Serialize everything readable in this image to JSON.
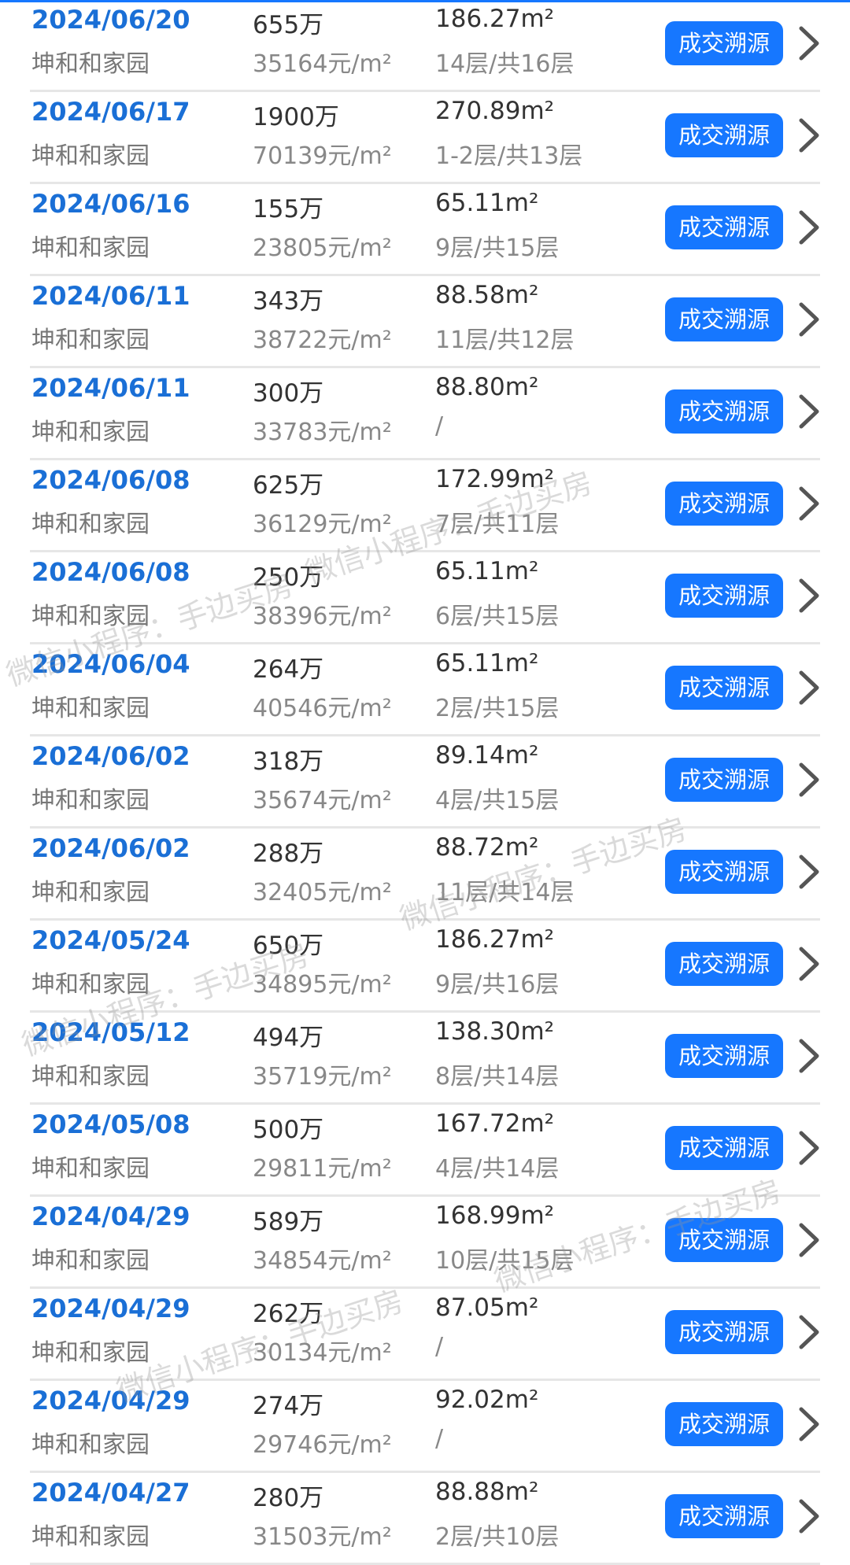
{
  "button_label": "成交溯源",
  "accent_color": "#1677ff",
  "icons": {
    "chevron": "chevron-right-icon"
  },
  "watermark_text": "微信小程序：手边买房",
  "records": [
    {
      "date": "2024/06/20",
      "community": "坤和和家园",
      "price": "655万",
      "unit_price": "35164元/m²",
      "area": "186.27m²",
      "floor": "14层/共16层"
    },
    {
      "date": "2024/06/17",
      "community": "坤和和家园",
      "price": "1900万",
      "unit_price": "70139元/m²",
      "area": "270.89m²",
      "floor": "1-2层/共13层"
    },
    {
      "date": "2024/06/16",
      "community": "坤和和家园",
      "price": "155万",
      "unit_price": "23805元/m²",
      "area": "65.11m²",
      "floor": "9层/共15层"
    },
    {
      "date": "2024/06/11",
      "community": "坤和和家园",
      "price": "343万",
      "unit_price": "38722元/m²",
      "area": "88.58m²",
      "floor": "11层/共12层"
    },
    {
      "date": "2024/06/11",
      "community": "坤和和家园",
      "price": "300万",
      "unit_price": "33783元/m²",
      "area": "88.80m²",
      "floor": "/"
    },
    {
      "date": "2024/06/08",
      "community": "坤和和家园",
      "price": "625万",
      "unit_price": "36129元/m²",
      "area": "172.99m²",
      "floor": "7层/共11层"
    },
    {
      "date": "2024/06/08",
      "community": "坤和和家园",
      "price": "250万",
      "unit_price": "38396元/m²",
      "area": "65.11m²",
      "floor": "6层/共15层"
    },
    {
      "date": "2024/06/04",
      "community": "坤和和家园",
      "price": "264万",
      "unit_price": "40546元/m²",
      "area": "65.11m²",
      "floor": "2层/共15层"
    },
    {
      "date": "2024/06/02",
      "community": "坤和和家园",
      "price": "318万",
      "unit_price": "35674元/m²",
      "area": "89.14m²",
      "floor": "4层/共15层"
    },
    {
      "date": "2024/06/02",
      "community": "坤和和家园",
      "price": "288万",
      "unit_price": "32405元/m²",
      "area": "88.72m²",
      "floor": "11层/共14层"
    },
    {
      "date": "2024/05/24",
      "community": "坤和和家园",
      "price": "650万",
      "unit_price": "34895元/m²",
      "area": "186.27m²",
      "floor": "9层/共16层"
    },
    {
      "date": "2024/05/12",
      "community": "坤和和家园",
      "price": "494万",
      "unit_price": "35719元/m²",
      "area": "138.30m²",
      "floor": "8层/共14层"
    },
    {
      "date": "2024/05/08",
      "community": "坤和和家园",
      "price": "500万",
      "unit_price": "29811元/m²",
      "area": "167.72m²",
      "floor": "4层/共14层"
    },
    {
      "date": "2024/04/29",
      "community": "坤和和家园",
      "price": "589万",
      "unit_price": "34854元/m²",
      "area": "168.99m²",
      "floor": "10层/共15层"
    },
    {
      "date": "2024/04/29",
      "community": "坤和和家园",
      "price": "262万",
      "unit_price": "30134元/m²",
      "area": "87.05m²",
      "floor": "/"
    },
    {
      "date": "2024/04/29",
      "community": "坤和和家园",
      "price": "274万",
      "unit_price": "29746元/m²",
      "area": "92.02m²",
      "floor": "/"
    },
    {
      "date": "2024/04/27",
      "community": "坤和和家园",
      "price": "280万",
      "unit_price": "31503元/m²",
      "area": "88.88m²",
      "floor": "2层/共10层"
    }
  ]
}
